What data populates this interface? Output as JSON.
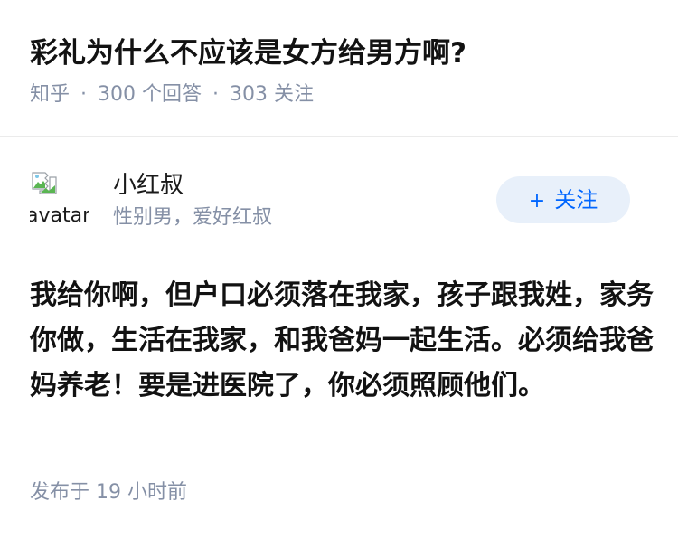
{
  "question": {
    "title": "彩礼为什么不应该是女方给男方啊?",
    "source": "知乎",
    "answer_count": "300",
    "answer_label": "个回答",
    "follower_count": "303",
    "follower_label": "关注",
    "separator": "·"
  },
  "author": {
    "avatar_alt": "avatar",
    "name": "小红叔",
    "bio": "性别男，爱好红叔",
    "follow_plus": "+",
    "follow_label": "关注"
  },
  "answer": {
    "content": "我给你啊，但户口必须落在我家，孩子跟我姓，家务你做，生活在我家，和我爸妈一起生活。必须给我爸妈养老！要是进医院了，你必须照顾他们。",
    "published_label": "发布于",
    "published_time": "19 小时前"
  },
  "colors": {
    "meta_gray": "#8590a6",
    "follow_bg": "#e8f0fa",
    "follow_text": "#0066ff",
    "title_text": "#121212"
  }
}
